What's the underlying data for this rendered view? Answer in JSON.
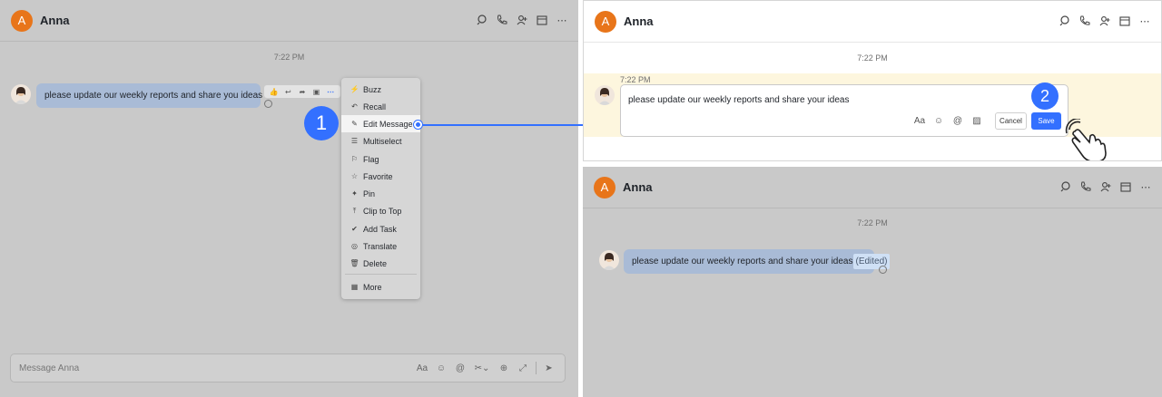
{
  "contact": {
    "name": "Anna",
    "initial": "A"
  },
  "header_icons": [
    "search-chat-icon",
    "call-icon",
    "add-member-icon",
    "calendar-icon",
    "more-icon"
  ],
  "time": "7:22 PM",
  "panel1": {
    "message": "please update our weekly reports and share you ideas",
    "toolbar_icons": [
      "thumbs-up-icon",
      "reply-icon",
      "forward-icon",
      "add-reaction-icon",
      "more-icon"
    ],
    "menu": [
      {
        "label": "Buzz",
        "icon": "lightning-icon",
        "glyph": "⚡"
      },
      {
        "label": "Recall",
        "icon": "recall-icon",
        "glyph": "↶"
      },
      {
        "label": "Edit Message",
        "icon": "pencil-icon",
        "glyph": "✎"
      },
      {
        "label": "Multiselect",
        "icon": "checklist-icon",
        "glyph": "☰"
      },
      {
        "label": "Flag",
        "icon": "flag-icon",
        "glyph": "⚐"
      },
      {
        "label": "Favorite",
        "icon": "star-icon",
        "glyph": "☆"
      },
      {
        "label": "Pin",
        "icon": "pin-icon",
        "glyph": "✦"
      },
      {
        "label": "Clip to Top",
        "icon": "clip-top-icon",
        "glyph": "⤒"
      },
      {
        "label": "Add Task",
        "icon": "task-icon",
        "glyph": "✔"
      },
      {
        "label": "Translate",
        "icon": "translate-icon",
        "glyph": "◎"
      },
      {
        "label": "Delete",
        "icon": "trash-icon",
        "glyph": "🗑"
      }
    ],
    "menu_more": "More",
    "input_placeholder": "Message Anna",
    "step": "1"
  },
  "panel2": {
    "time": "7:22 PM",
    "edit_text": "please update our weekly reports and share your ideas",
    "cancel": "Cancel",
    "save": "Save",
    "step": "2"
  },
  "panel3": {
    "message": "please update our weekly reports and share your ideas",
    "edited": "(Edited)"
  },
  "colors": {
    "accent": "#3370ff",
    "avatar": "#e8751a",
    "highlight": "#fdf6de"
  }
}
